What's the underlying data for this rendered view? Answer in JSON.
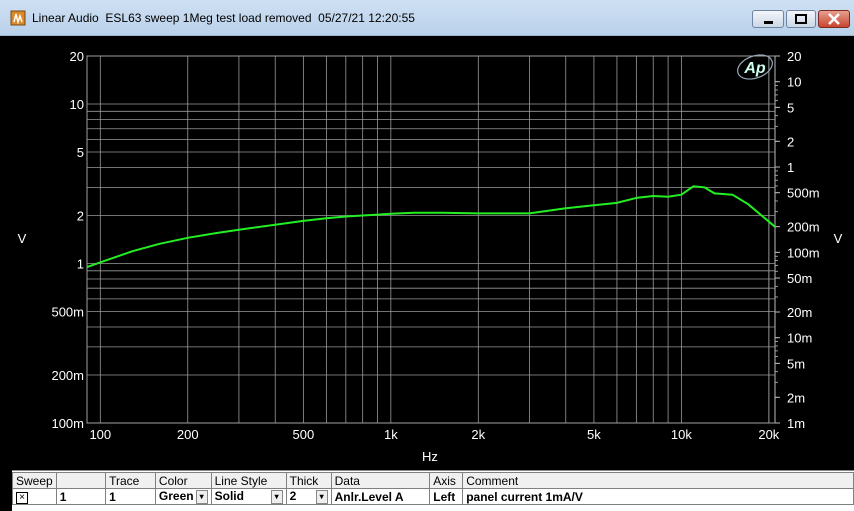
{
  "window": {
    "title": "Linear Audio  ESL63 sweep 1Meg test load removed  05/27/21 12:20:55",
    "logo": "Ap"
  },
  "chart_data": {
    "type": "line",
    "xlabel": "Hz",
    "ylabel_left": "V",
    "ylabel_right": "V",
    "x_scale": "log",
    "y_scale": "log",
    "xlim": [
      90,
      21000
    ],
    "ylim": [
      0.1,
      20
    ],
    "x_ticks": [
      {
        "v": 100,
        "label": "100"
      },
      {
        "v": 200,
        "label": "200"
      },
      {
        "v": 500,
        "label": "500"
      },
      {
        "v": 1000,
        "label": "1k"
      },
      {
        "v": 2000,
        "label": "2k"
      },
      {
        "v": 5000,
        "label": "5k"
      },
      {
        "v": 10000,
        "label": "10k"
      },
      {
        "v": 20000,
        "label": "20k"
      }
    ],
    "y_ticks_left": [
      {
        "v": 20,
        "label": "20"
      },
      {
        "v": 10,
        "label": "10"
      },
      {
        "v": 5,
        "label": "5"
      },
      {
        "v": 2,
        "label": "2"
      },
      {
        "v": 1,
        "label": "1"
      },
      {
        "v": 0.5,
        "label": "500m"
      },
      {
        "v": 0.2,
        "label": "200m"
      },
      {
        "v": 0.1,
        "label": "100m"
      }
    ],
    "y_ticks_right": [
      {
        "v": 20,
        "label": "20"
      },
      {
        "v": 10,
        "label": "10"
      },
      {
        "v": 5,
        "label": "5"
      },
      {
        "v": 2,
        "label": "2"
      },
      {
        "v": 1,
        "label": "1"
      },
      {
        "v": 0.5,
        "label": "500m"
      },
      {
        "v": 0.2,
        "label": "200m"
      },
      {
        "v": 0.1,
        "label": "100m"
      },
      {
        "v": 0.05,
        "label": "50m"
      },
      {
        "v": 0.02,
        "label": "20m"
      },
      {
        "v": 0.01,
        "label": "10m"
      },
      {
        "v": 0.005,
        "label": "5m"
      },
      {
        "v": 0.002,
        "label": "2m"
      },
      {
        "v": 0.001,
        "label": "1m"
      }
    ],
    "grid": true,
    "series": [
      {
        "color": "#22ee22",
        "x": [
          90,
          110,
          130,
          160,
          200,
          250,
          300,
          400,
          500,
          600,
          700,
          800,
          1000,
          1200,
          1500,
          2000,
          3000,
          4000,
          5000,
          6000,
          7000,
          8000,
          9000,
          10000,
          11000,
          12000,
          13000,
          15000,
          17000,
          21000
        ],
        "y": [
          0.95,
          1.08,
          1.2,
          1.33,
          1.45,
          1.55,
          1.63,
          1.75,
          1.85,
          1.92,
          1.97,
          2.0,
          2.05,
          2.08,
          2.08,
          2.06,
          2.06,
          2.22,
          2.32,
          2.4,
          2.58,
          2.65,
          2.62,
          2.7,
          3.05,
          3.0,
          2.75,
          2.7,
          2.35,
          1.7
        ]
      }
    ]
  },
  "legend_table": {
    "headers": [
      "Sweep",
      "Trace",
      "Color",
      "Line Style",
      "Thick",
      "Data",
      "Axis",
      "Comment"
    ],
    "row": {
      "checked": "×",
      "sweep": "1",
      "trace": "1",
      "color": "Green",
      "line_style": "Solid",
      "thick": "2",
      "data": "Anlr.Level A",
      "axis": "Left",
      "comment": "panel current 1mA/V"
    },
    "dropdown_glyph": "▾"
  }
}
